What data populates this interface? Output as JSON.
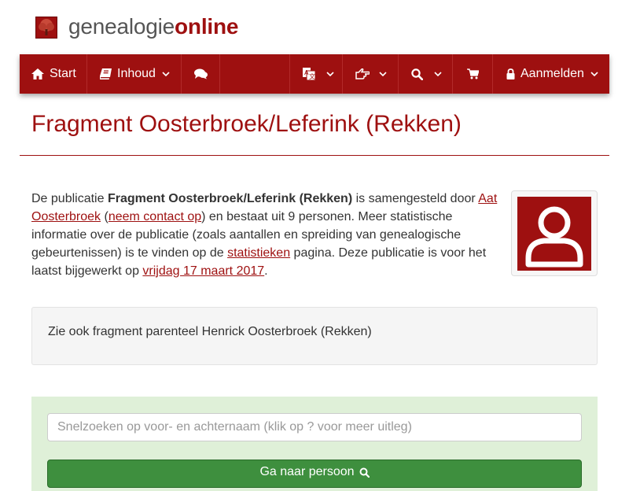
{
  "header": {
    "logo_icon": "tree-icon",
    "brand_part1": "genealogie",
    "brand_part2": "online",
    "brand_color": "#9e1010"
  },
  "navbar": {
    "items": [
      {
        "label": "Start",
        "icon": "home-icon"
      },
      {
        "label": "Inhoud",
        "icon": "book-icon",
        "has_dropdown": true
      },
      {
        "label": "",
        "icon": "chat-icon"
      },
      {
        "label": "",
        "icon": "translate-icon",
        "has_dropdown": true
      },
      {
        "label": "",
        "icon": "hand-pointer-icon",
        "has_dropdown": true
      },
      {
        "label": "",
        "icon": "search-icon",
        "has_dropdown": true
      },
      {
        "label": "",
        "icon": "cart-icon"
      },
      {
        "label": "Aanmelden",
        "icon": "lock-icon",
        "has_dropdown": true
      }
    ]
  },
  "page": {
    "title": "Fragment Oosterbroek/Leferink (Rekken)"
  },
  "intro": {
    "t1": "De publicatie ",
    "pub_name": "Fragment Oosterbroek/Leferink (Rekken)",
    "t2": " is samengesteld door ",
    "author": "Aat Oosterbroek",
    "t3": " (",
    "contact": "neem contact op",
    "t4": ") en bestaat uit 9 personen. Meer statistische informatie over de publicatie (zoals aantallen en spreiding van genealogische gebeurtenissen) is te vinden op de ",
    "stats_link": "statistieken",
    "t5": " pagina. Deze publicatie is voor het laatst bijgewerkt op ",
    "date_link": "vrijdag 17 maart 2017",
    "t6": "."
  },
  "see_also": {
    "text": "Zie ook fragment parenteel Henrick Oosterbroek (Rekken)"
  },
  "search": {
    "placeholder": "Snelzoeken op voor- en achternaam (klik op ? voor meer uitleg)",
    "button_label": "Ga naar persoon",
    "panel_color": "#dff0d8",
    "button_color": "#3e8f3e"
  }
}
